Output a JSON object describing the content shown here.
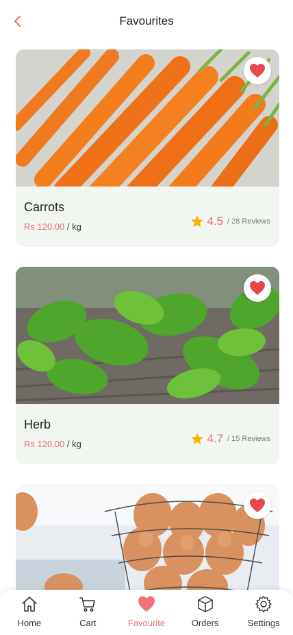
{
  "header": {
    "title": "Favourites"
  },
  "products": [
    {
      "name": "Carrots",
      "price": "Rs 120.00",
      "unit": " / kg",
      "rating": "4.5",
      "reviews": "/ 28 Reviews"
    },
    {
      "name": "Herb",
      "price": "Rs 120.00",
      "unit": " / kg",
      "rating": "4.7",
      "reviews": "/ 15 Reviews"
    }
  ],
  "nav": {
    "home": "Home",
    "cart": "Cart",
    "favourite": "Favourite",
    "orders": "Orders",
    "settings": "Settings"
  },
  "colors": {
    "accent": "#ef6b73",
    "star": "#f5b400",
    "card_bg": "#f2f6f1"
  }
}
